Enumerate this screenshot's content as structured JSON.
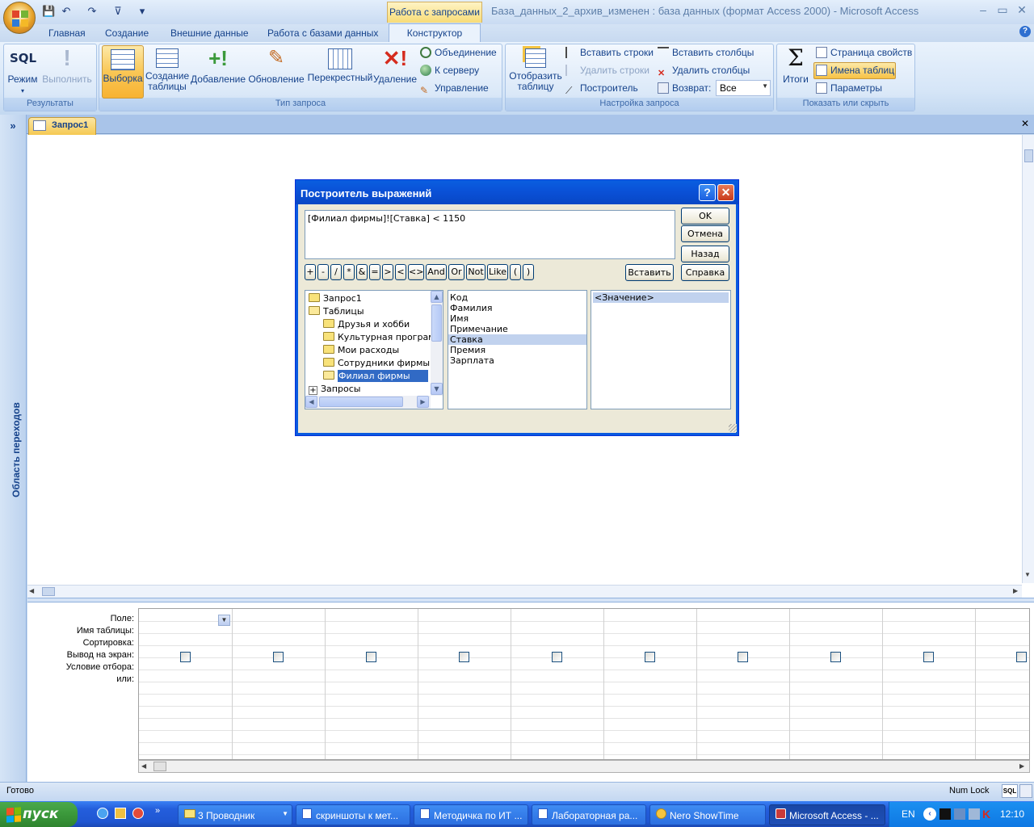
{
  "window": {
    "title": "База_данных_2_архив_изменен : база данных (формат Access 2000) - Microsoft Access",
    "context_tab": "Работа с запросами"
  },
  "tabs": [
    "Главная",
    "Создание",
    "Внешние данные",
    "Работа с базами данных",
    "Конструктор"
  ],
  "ribbon": {
    "results": {
      "label": "Результаты",
      "view": "Режим",
      "run": "Выполнить",
      "view_icon_text": "SQL"
    },
    "query_type": {
      "label": "Тип запроса",
      "select": "Выборка",
      "make_table_1": "Создание",
      "make_table_2": "таблицы",
      "append": "Добавление",
      "update": "Обновление",
      "crosstab": "Перекрестный",
      "delete": "Удаление",
      "union": "Объединение",
      "pass_through": "К серверу",
      "data_definition": "Управление"
    },
    "query_setup": {
      "label": "Настройка запроса",
      "show_table_1": "Отобразить",
      "show_table_2": "таблицу",
      "insert_rows": "Вставить строки",
      "delete_rows": "Удалить строки",
      "builder": "Построитель",
      "insert_columns": "Вставить столбцы",
      "delete_columns": "Удалить столбцы",
      "return_label": "Возврат:",
      "return_value": "Все"
    },
    "show_hide": {
      "label": "Показать или скрыть",
      "totals": "Итоги",
      "totals_icon": "Σ",
      "property_sheet": "Страница свойств",
      "table_names": "Имена таблиц",
      "parameters": "Параметры"
    }
  },
  "nav_pane": {
    "label": "Область переходов",
    "toggle": "»"
  },
  "document": {
    "tab": "Запрос1",
    "close": "✕"
  },
  "grid": {
    "rows": [
      "Поле:",
      "Имя таблицы:",
      "Сортировка:",
      "Вывод на экран:",
      "Условие отбора:",
      "или:"
    ],
    "columns": 10
  },
  "status": {
    "left": "Готово",
    "numlock": "Num Lock",
    "sql_btn": "SQL"
  },
  "dialog": {
    "title": "Построитель выражений",
    "help": "?",
    "close": "✕",
    "expression": "[Филиал фирмы]![Ставка] < 1150",
    "buttons": {
      "ok": "OK",
      "cancel": "Отмена",
      "undo": "Назад",
      "paste": "Вставить",
      "help": "Справка"
    },
    "operators": [
      "+",
      "-",
      "/",
      "*",
      "&",
      "=",
      ">",
      "<",
      "<>",
      "And",
      "Or",
      "Not",
      "Like",
      "(",
      ")"
    ],
    "tree": [
      {
        "label": "Запрос1",
        "level": 0,
        "icon": "folder-icon"
      },
      {
        "label": "Таблицы",
        "level": 0,
        "icon": "folder-open-icon"
      },
      {
        "label": "Друзья и хобби",
        "level": 1,
        "icon": "folder-icon"
      },
      {
        "label": "Культурная программа",
        "level": 1,
        "icon": "folder-icon"
      },
      {
        "label": "Мои расходы",
        "level": 1,
        "icon": "folder-icon"
      },
      {
        "label": "Сотрудники фирмы",
        "level": 1,
        "icon": "folder-icon"
      },
      {
        "label": "Филиал фирмы",
        "level": 1,
        "icon": "folder-open-icon",
        "selected": true
      },
      {
        "label": "Запросы",
        "level": 0,
        "icon": "plus-box-icon"
      }
    ],
    "fields": [
      "Код",
      "Фамилия",
      "Имя",
      "Примечание",
      "Ставка",
      "Премия",
      "Зарплата"
    ],
    "selected_field": "Ставка",
    "values": [
      "<Значение>"
    ]
  },
  "taskbar": {
    "start": "пуск",
    "tasks": [
      {
        "label": "3 Проводник",
        "icon": "folder-icon"
      },
      {
        "label": "скриншоты к мет...",
        "icon": "word-icon"
      },
      {
        "label": "Методичка по ИТ ...",
        "icon": "word-icon"
      },
      {
        "label": "Лабораторная ра...",
        "icon": "word-icon"
      },
      {
        "label": "Nero ShowTime",
        "icon": "nero-icon"
      },
      {
        "label": "Microsoft Access - ...",
        "icon": "access-icon"
      }
    ],
    "lang": "EN",
    "clock": "12:10"
  }
}
